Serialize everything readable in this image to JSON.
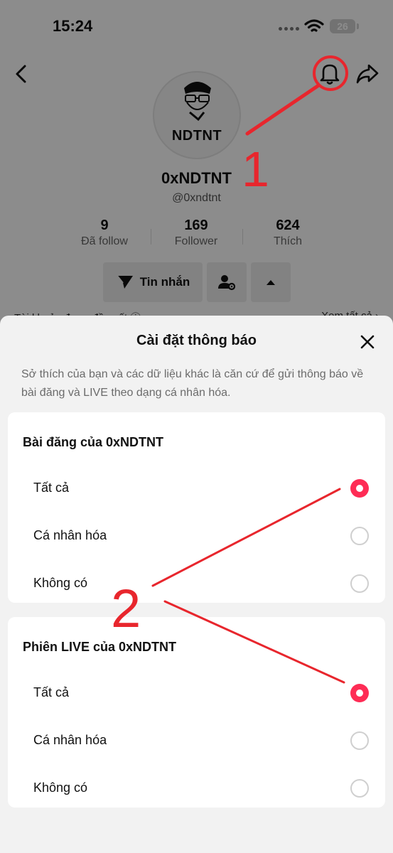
{
  "status_bar": {
    "time": "15:24",
    "battery": "26"
  },
  "profile": {
    "avatar_text": "NDTNT",
    "display_name": "0xNDTNT",
    "handle": "@0xndtnt",
    "stats": [
      {
        "value": "9",
        "label": "Đã follow"
      },
      {
        "value": "169",
        "label": "Follower"
      },
      {
        "value": "624",
        "label": "Thích"
      }
    ],
    "message_button": "Tin nhắn",
    "suggested_label": "Tài khoản được đề xuất ⓘ",
    "see_all_label": "Xem tất cả ›"
  },
  "sheet": {
    "title": "Cài đặt thông báo",
    "description": "Sở thích của bạn và các dữ liệu khác là căn cứ để gửi thông báo về bài đăng và LIVE theo dạng cá nhân hóa.",
    "sections": [
      {
        "title": "Bài đăng của 0xNDTNT",
        "options": [
          {
            "label": "Tất cả",
            "selected": true
          },
          {
            "label": "Cá nhân hóa",
            "selected": false
          },
          {
            "label": "Không có",
            "selected": false
          }
        ]
      },
      {
        "title": "Phiên LIVE của 0xNDTNT",
        "options": [
          {
            "label": "Tất cả",
            "selected": true
          },
          {
            "label": "Cá nhân hóa",
            "selected": false
          },
          {
            "label": "Không có",
            "selected": false
          }
        ]
      }
    ]
  },
  "annotations": {
    "step1": "1",
    "step2": "2",
    "color": "#e8262d"
  },
  "colors": {
    "accent": "#fe2c55",
    "sheet_bg": "#f2f2f2"
  }
}
